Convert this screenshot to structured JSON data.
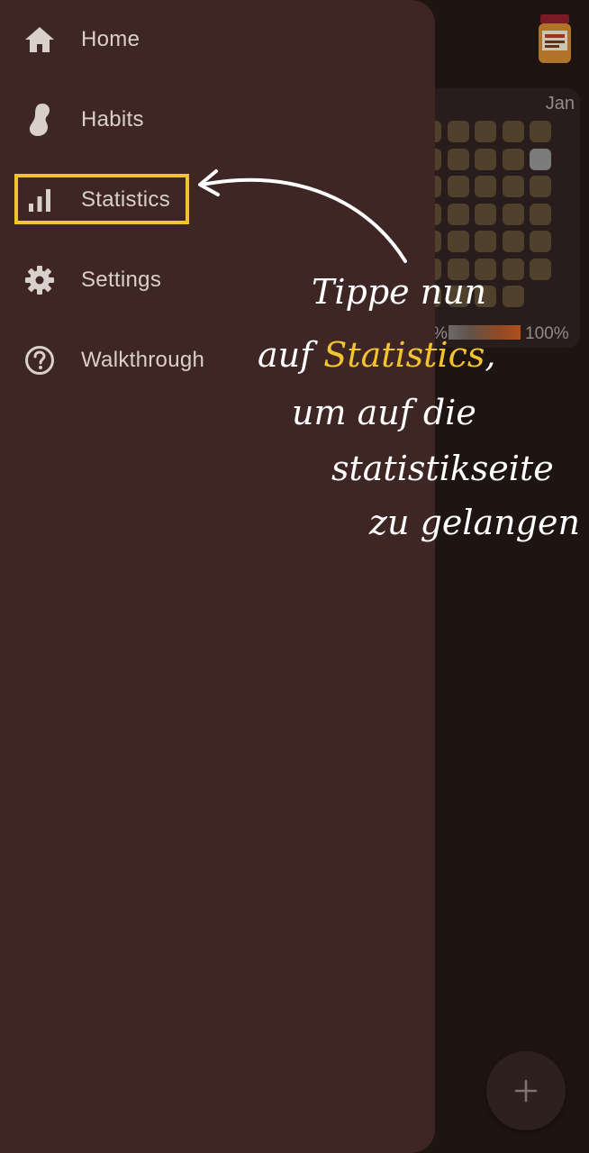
{
  "nav": {
    "items": [
      {
        "label": "Home",
        "icon": "home-icon"
      },
      {
        "label": "Habits",
        "icon": "peanut-icon"
      },
      {
        "label": "Statistics",
        "icon": "bar-chart-icon"
      },
      {
        "label": "Settings",
        "icon": "gear-icon"
      },
      {
        "label": "Walkthrough",
        "icon": "help-circle-icon"
      }
    ],
    "highlighted": "Statistics"
  },
  "background": {
    "month_label": "Jan",
    "legend_min": "%",
    "legend_max": "100%",
    "fab_label": "+"
  },
  "annotation": {
    "line1": "Tippe nun",
    "line2_prefix": "auf ",
    "line2_highlight": "Statistics",
    "line2_suffix": ",",
    "line3": "um auf die",
    "line4": "statistikseite",
    "line5": "zu gelangen"
  },
  "colors": {
    "drawer_bg": "#3d2623",
    "highlight": "#f4c430",
    "text": "#d9cfcb",
    "annotation_text": "#ffffff"
  }
}
